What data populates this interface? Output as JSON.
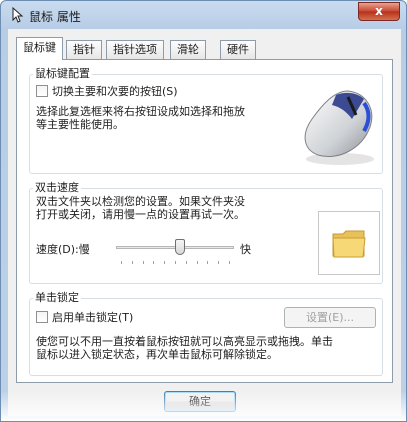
{
  "window": {
    "title": "鼠标 属性",
    "close_glyph": "x"
  },
  "tabs": [
    {
      "label": "鼠标键",
      "active": true
    },
    {
      "label": "指针",
      "active": false
    },
    {
      "label": "指针选项",
      "active": false
    },
    {
      "label": "滑轮",
      "active": false
    },
    {
      "label": "硬件",
      "active": false
    }
  ],
  "button_config": {
    "group_label": "鼠标键配置",
    "checkbox_label": "切换主要和次要的按钮(S)",
    "checked": false,
    "description_line1": "选择此复选框来将右按钮设成如选择和拖放",
    "description_line2": "等主要性能使用。",
    "icon": "mouse-icon"
  },
  "double_click": {
    "group_label": "双击速度",
    "description_line1": "双击文件夹以检测您的设置。如果文件夹没",
    "description_line2": "打开或关闭，请用慢一点的设置再试一次。",
    "speed_label": "速度(D):",
    "slow_label": "慢",
    "fast_label": "快",
    "speed_level": 0.55,
    "test_icon": "folder-icon"
  },
  "click_lock": {
    "group_label": "单击锁定",
    "checkbox_label": "启用单击锁定(T)",
    "checked": false,
    "settings_button": "设置(E)...",
    "description_line1": "使您可以不用一直按着鼠标按钮就可以高亮显示或拖拽。单击",
    "description_line2": "鼠标以进入锁定状态，再次单击鼠标可解除锁定。"
  },
  "footer": {
    "ok_button": "确定"
  }
}
